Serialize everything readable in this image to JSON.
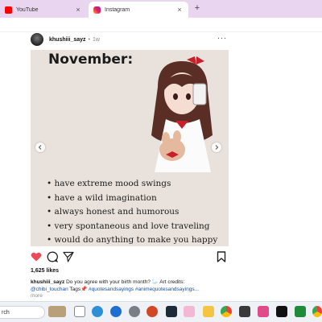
{
  "browser": {
    "tabs": [
      {
        "label": "YouTube",
        "icon": "youtube-icon"
      },
      {
        "label": "Instagram",
        "icon": "instagram-icon"
      }
    ],
    "new_tab": "+",
    "close": "×"
  },
  "post": {
    "username": "khushiii_sayz",
    "separator": "•",
    "age": "1w",
    "more": "···",
    "image": {
      "title": "November:",
      "bullets": [
        "have extreme mood swings",
        "have a wild imagination",
        "always honest and humorous",
        "very spontaneous and love traveling",
        "would do anything to make you happy"
      ]
    },
    "likes": "1,625 likes",
    "caption_user": "khushiii_sayz",
    "caption_text": " Do you agree with your birth month? 🦢 Art credits:",
    "caption_line2_mention": "@chibi_touchan",
    "caption_line2_text": " Tags📌 ",
    "caption_hashtags": "#quotesandsayings #animequotesandsayings...",
    "more_link": "more",
    "colors": {
      "heart": "#ed4956",
      "link": "#1a4fa0",
      "image_bg": "#e9e2dc"
    }
  },
  "taskbar": {
    "search_label": "rch",
    "icons": [
      "pinned-photo-icon",
      "task-view-icon",
      "edge-icon",
      "settings-icon",
      "powerpoint-icon",
      "app-icon",
      "game-icon",
      "file-explorer-icon",
      "chrome-icon",
      "paint-icon",
      "movie-icon",
      "tiktok-icon",
      "xbox-icon",
      "chrome-profile-icon"
    ]
  }
}
